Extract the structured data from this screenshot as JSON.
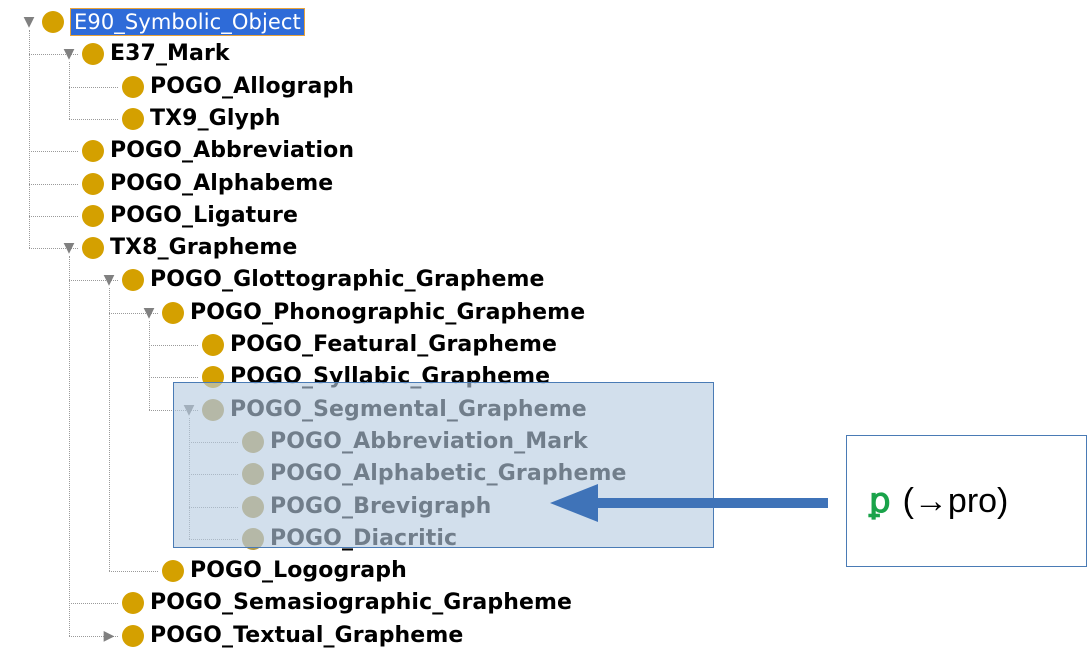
{
  "colors": {
    "node": "#d4a000",
    "node_highlighted": "#b39a4a",
    "selection_bg": "#2e6bd8",
    "selection_border": "#e8a33b",
    "highlight_border": "#4a7bb5",
    "arrow": "#3f73b8",
    "glyph": "#1aa34a"
  },
  "tree": {
    "nodes": [
      {
        "label": "E90_Symbolic_Object",
        "toggle": "expanded",
        "selected": true
      },
      {
        "label": "E37_Mark",
        "toggle": "expanded"
      },
      {
        "label": "POGO_Allograph",
        "toggle": "none"
      },
      {
        "label": "TX9_Glyph",
        "toggle": "none"
      },
      {
        "label": "POGO_Abbreviation",
        "toggle": "none"
      },
      {
        "label": "POGO_Alphabeme",
        "toggle": "none"
      },
      {
        "label": "POGO_Ligature",
        "toggle": "none"
      },
      {
        "label": "TX8_Grapheme",
        "toggle": "expanded"
      },
      {
        "label": "POGO_Glottographic_Grapheme",
        "toggle": "expanded"
      },
      {
        "label": "POGO_Phonographic_Grapheme",
        "toggle": "expanded"
      },
      {
        "label": "POGO_Featural_Grapheme",
        "toggle": "none"
      },
      {
        "label": "POGO_Syllabic_Grapheme",
        "toggle": "none"
      },
      {
        "label": "POGO_Segmental_Grapheme",
        "toggle": "expanded",
        "highlighted": true
      },
      {
        "label": "POGO_Abbreviation_Mark",
        "toggle": "none",
        "highlighted": true
      },
      {
        "label": "POGO_Alphabetic_Grapheme",
        "toggle": "none",
        "highlighted": true
      },
      {
        "label": "POGO_Brevigraph",
        "toggle": "none",
        "highlighted": true
      },
      {
        "label": "POGO_Diacritic",
        "toggle": "none",
        "highlighted": true
      },
      {
        "label": "POGO_Logograph",
        "toggle": "none"
      },
      {
        "label": "POGO_Semasiographic_Grapheme",
        "toggle": "none"
      },
      {
        "label": "POGO_Textual_Grapheme",
        "toggle": "collapsed"
      }
    ]
  },
  "callout": {
    "glyph": "ꝑ",
    "text": "(→pro)"
  }
}
